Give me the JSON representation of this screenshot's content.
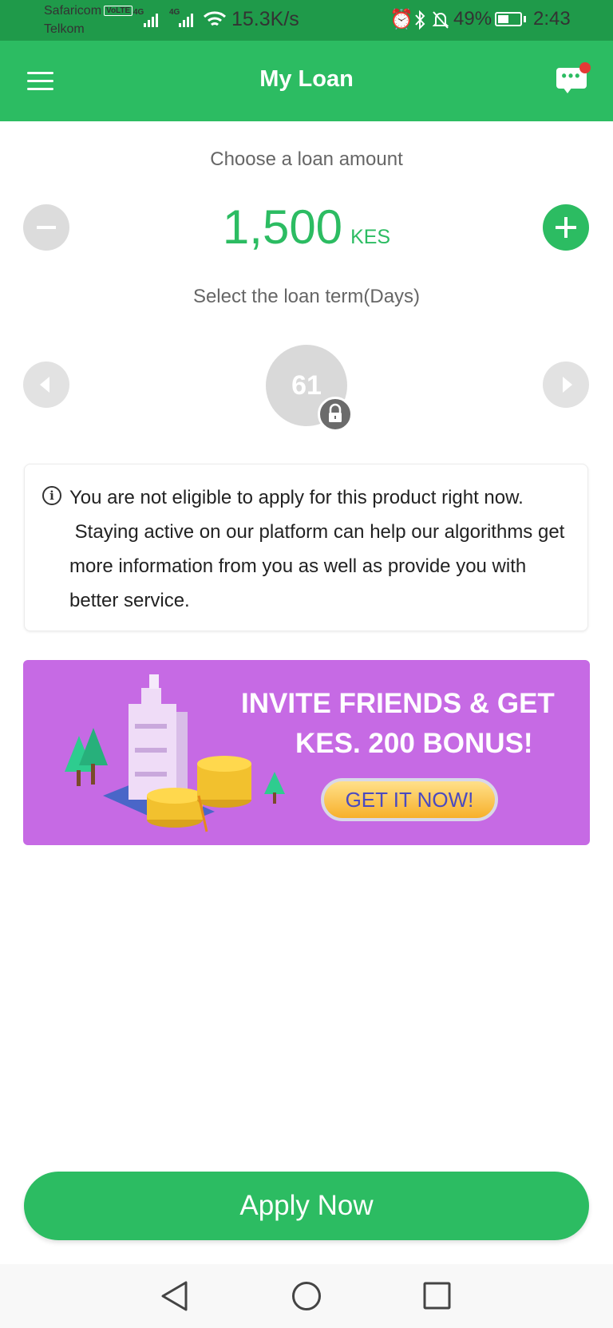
{
  "status_bar": {
    "carrier1": "Safaricom",
    "volte": "VoLTE",
    "carrier2": "Telkom",
    "net1": "4G",
    "net2": "4G",
    "speed": "15.3K/s",
    "battery": "49%",
    "battery_level": 0.49,
    "time": "2:43"
  },
  "app_bar": {
    "title": "My Loan",
    "has_notification": true
  },
  "loan": {
    "amount_label": "Choose a loan amount",
    "amount": "1,500",
    "currency": "KES",
    "term_label": "Select the loan term(Days)",
    "term_days": "61",
    "term_locked": true
  },
  "notice": {
    "text": "You are not eligible to apply for this product right now.\n Staying active on our platform can help our algorithms get more information from you as well as provide you with better service."
  },
  "banner": {
    "line1": "INVITE FRIENDS & GET",
    "line2": "KES. 200 BONUS!",
    "cta": "GET IT NOW!",
    "background": "#c66ae4"
  },
  "apply_button": "Apply Now",
  "colors": {
    "accent": "#2cbc62",
    "status_bar": "#1f9a4a"
  }
}
